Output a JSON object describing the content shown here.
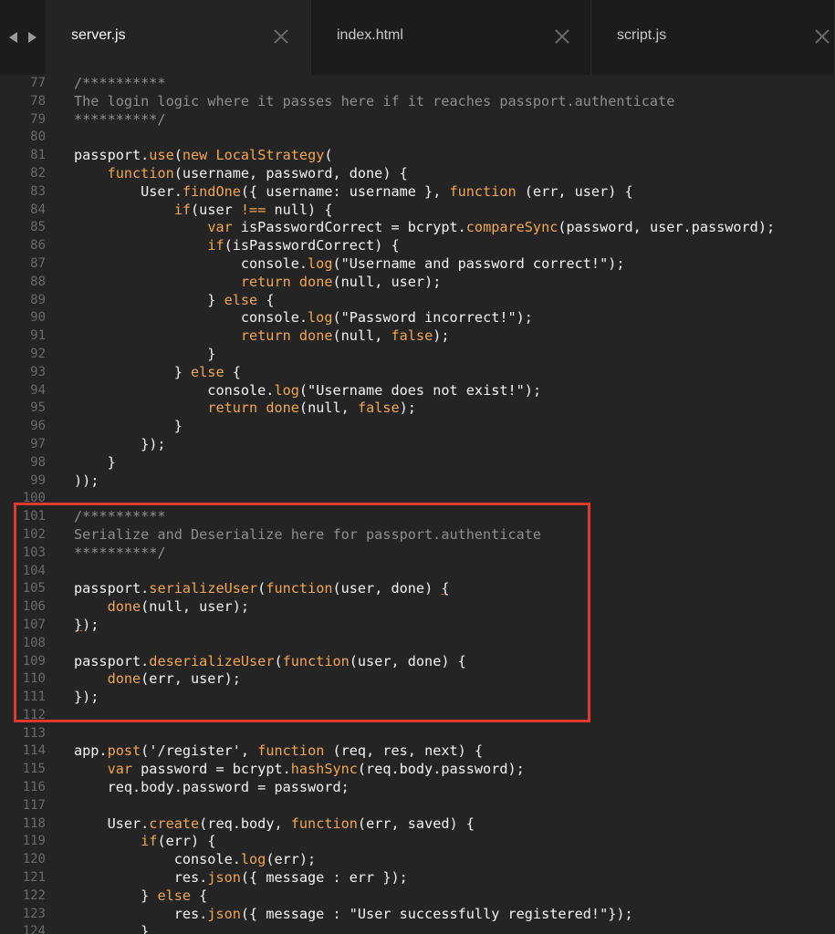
{
  "tabs": [
    {
      "label": "server.js",
      "active": true
    },
    {
      "label": "index.html",
      "active": false
    },
    {
      "label": "script.js",
      "active": false
    }
  ],
  "colors": {
    "background": "#242424",
    "tabbar": "#1c1c1c",
    "line_number": "#6a6a6a",
    "plain": "#f4f4f4",
    "comment": "#8e8e8e",
    "keyword": "#f2a64f",
    "highlight_box": "#e03a2f"
  },
  "icons": {
    "nav_back": "triangle-left-icon",
    "nav_forward": "triangle-right-icon",
    "tab_close": "close-x-icon"
  },
  "highlight": {
    "first_line": 101,
    "last_line": 112
  },
  "lines": [
    {
      "n": "77",
      "t": [
        [
          "c",
          "/**********"
        ]
      ]
    },
    {
      "n": "78",
      "t": [
        [
          "c",
          "The login logic where it passes here if it reaches passport.authenticate"
        ]
      ]
    },
    {
      "n": "79",
      "t": [
        [
          "c",
          "**********/"
        ]
      ]
    },
    {
      "n": "80",
      "t": []
    },
    {
      "n": "81",
      "t": [
        [
          "p",
          "passport."
        ],
        [
          "m",
          "use"
        ],
        [
          "p",
          "("
        ],
        [
          "k",
          "new"
        ],
        [
          "p",
          " "
        ],
        [
          "m",
          "LocalStrategy"
        ],
        [
          "p",
          "("
        ]
      ]
    },
    {
      "n": "82",
      "t": [
        [
          "p",
          "    "
        ],
        [
          "k",
          "function"
        ],
        [
          "p",
          "(username, password, done) {"
        ]
      ]
    },
    {
      "n": "83",
      "t": [
        [
          "p",
          "        User."
        ],
        [
          "m",
          "findOne"
        ],
        [
          "p",
          "({ username: username }, "
        ],
        [
          "k",
          "function"
        ],
        [
          "p",
          " (err, user) {"
        ]
      ]
    },
    {
      "n": "84",
      "t": [
        [
          "p",
          "            "
        ],
        [
          "k",
          "if"
        ],
        [
          "p",
          "(user "
        ],
        [
          "k",
          "!=="
        ],
        [
          "p",
          " null) {"
        ]
      ]
    },
    {
      "n": "85",
      "t": [
        [
          "p",
          "                "
        ],
        [
          "k",
          "var"
        ],
        [
          "p",
          " isPasswordCorrect = bcrypt."
        ],
        [
          "m",
          "compareSync"
        ],
        [
          "p",
          "(password, user.password);"
        ]
      ]
    },
    {
      "n": "86",
      "t": [
        [
          "p",
          "                "
        ],
        [
          "k",
          "if"
        ],
        [
          "p",
          "(isPasswordCorrect) {"
        ]
      ]
    },
    {
      "n": "87",
      "t": [
        [
          "p",
          "                    console."
        ],
        [
          "m",
          "log"
        ],
        [
          "p",
          "("
        ],
        [
          "s",
          "\"Username and password correct!\""
        ],
        [
          "p",
          ");"
        ]
      ]
    },
    {
      "n": "88",
      "t": [
        [
          "p",
          "                    "
        ],
        [
          "k",
          "return"
        ],
        [
          "p",
          " "
        ],
        [
          "m",
          "done"
        ],
        [
          "p",
          "(null, user);"
        ]
      ]
    },
    {
      "n": "89",
      "t": [
        [
          "p",
          "                } "
        ],
        [
          "k",
          "else"
        ],
        [
          "p",
          " {"
        ]
      ]
    },
    {
      "n": "90",
      "t": [
        [
          "p",
          "                    console."
        ],
        [
          "m",
          "log"
        ],
        [
          "p",
          "("
        ],
        [
          "s",
          "\"Password incorrect!\""
        ],
        [
          "p",
          ");"
        ]
      ]
    },
    {
      "n": "91",
      "t": [
        [
          "p",
          "                    "
        ],
        [
          "k",
          "return"
        ],
        [
          "p",
          " "
        ],
        [
          "m",
          "done"
        ],
        [
          "p",
          "(null, "
        ],
        [
          "k",
          "false"
        ],
        [
          "p",
          ");"
        ]
      ]
    },
    {
      "n": "92",
      "t": [
        [
          "p",
          "                }"
        ]
      ]
    },
    {
      "n": "93",
      "t": [
        [
          "p",
          "            } "
        ],
        [
          "k",
          "else"
        ],
        [
          "p",
          " {"
        ]
      ]
    },
    {
      "n": "94",
      "t": [
        [
          "p",
          "                console."
        ],
        [
          "m",
          "log"
        ],
        [
          "p",
          "("
        ],
        [
          "s",
          "\"Username does not exist!\""
        ],
        [
          "p",
          ");"
        ]
      ]
    },
    {
      "n": "95",
      "t": [
        [
          "p",
          "                "
        ],
        [
          "k",
          "return"
        ],
        [
          "p",
          " "
        ],
        [
          "m",
          "done"
        ],
        [
          "p",
          "(null, "
        ],
        [
          "k",
          "false"
        ],
        [
          "p",
          ");"
        ]
      ]
    },
    {
      "n": "96",
      "t": [
        [
          "p",
          "            }"
        ]
      ]
    },
    {
      "n": "97",
      "t": [
        [
          "p",
          "        });"
        ]
      ]
    },
    {
      "n": "98",
      "t": [
        [
          "p",
          "    }"
        ]
      ]
    },
    {
      "n": "99",
      "t": [
        [
          "p",
          "));"
        ]
      ]
    },
    {
      "n": "100",
      "t": []
    },
    {
      "n": "101",
      "t": [
        [
          "c",
          "/**********"
        ]
      ]
    },
    {
      "n": "102",
      "t": [
        [
          "c",
          "Serialize and Deserialize here for passport.authenticate"
        ]
      ]
    },
    {
      "n": "103",
      "t": [
        [
          "c",
          "**********/"
        ]
      ]
    },
    {
      "n": "104",
      "t": []
    },
    {
      "n": "105",
      "t": [
        [
          "p",
          "passport."
        ],
        [
          "m",
          "serializeUser"
        ],
        [
          "p",
          "("
        ],
        [
          "k",
          "function"
        ],
        [
          "p",
          "(user, done) "
        ],
        [
          "e",
          "{"
        ]
      ]
    },
    {
      "n": "106",
      "t": [
        [
          "p",
          "    "
        ],
        [
          "m",
          "done"
        ],
        [
          "p",
          "(null, user);"
        ]
      ]
    },
    {
      "n": "107",
      "t": [
        [
          "e",
          "}"
        ],
        [
          "p",
          ");"
        ]
      ]
    },
    {
      "n": "108",
      "t": []
    },
    {
      "n": "109",
      "t": [
        [
          "p",
          "passport."
        ],
        [
          "m",
          "deserializeUser"
        ],
        [
          "p",
          "("
        ],
        [
          "k",
          "function"
        ],
        [
          "p",
          "(user, done) {"
        ]
      ]
    },
    {
      "n": "110",
      "t": [
        [
          "p",
          "    "
        ],
        [
          "m",
          "done"
        ],
        [
          "p",
          "(err, user);"
        ]
      ]
    },
    {
      "n": "111",
      "t": [
        [
          "p",
          "});"
        ]
      ]
    },
    {
      "n": "112",
      "t": []
    },
    {
      "n": "113",
      "t": []
    },
    {
      "n": "114",
      "t": [
        [
          "p",
          "app."
        ],
        [
          "m",
          "post"
        ],
        [
          "p",
          "("
        ],
        [
          "s",
          "'/register'"
        ],
        [
          "p",
          ", "
        ],
        [
          "k",
          "function"
        ],
        [
          "p",
          " (req, res, next) {"
        ]
      ]
    },
    {
      "n": "115",
      "t": [
        [
          "p",
          "    "
        ],
        [
          "k",
          "var"
        ],
        [
          "p",
          " password = bcrypt."
        ],
        [
          "m",
          "hashSync"
        ],
        [
          "p",
          "(req.body.password);"
        ]
      ]
    },
    {
      "n": "116",
      "t": [
        [
          "p",
          "    req.body.password = password;"
        ]
      ]
    },
    {
      "n": "117",
      "t": []
    },
    {
      "n": "118",
      "t": [
        [
          "p",
          "    User."
        ],
        [
          "m",
          "create"
        ],
        [
          "p",
          "(req.body, "
        ],
        [
          "k",
          "function"
        ],
        [
          "p",
          "(err, saved) {"
        ]
      ]
    },
    {
      "n": "119",
      "t": [
        [
          "p",
          "        "
        ],
        [
          "k",
          "if"
        ],
        [
          "p",
          "(err) {"
        ]
      ]
    },
    {
      "n": "120",
      "t": [
        [
          "p",
          "            console."
        ],
        [
          "m",
          "log"
        ],
        [
          "p",
          "(err);"
        ]
      ]
    },
    {
      "n": "121",
      "t": [
        [
          "p",
          "            res."
        ],
        [
          "m",
          "json"
        ],
        [
          "p",
          "({ message : err });"
        ]
      ]
    },
    {
      "n": "122",
      "t": [
        [
          "p",
          "        } "
        ],
        [
          "k",
          "else"
        ],
        [
          "p",
          " {"
        ]
      ]
    },
    {
      "n": "123",
      "t": [
        [
          "p",
          "            res."
        ],
        [
          "m",
          "json"
        ],
        [
          "p",
          "({ message : "
        ],
        [
          "s",
          "\"User successfully registered!\""
        ],
        [
          "p",
          "});"
        ]
      ]
    },
    {
      "n": "124",
      "t": [
        [
          "p",
          "        }"
        ]
      ]
    }
  ]
}
